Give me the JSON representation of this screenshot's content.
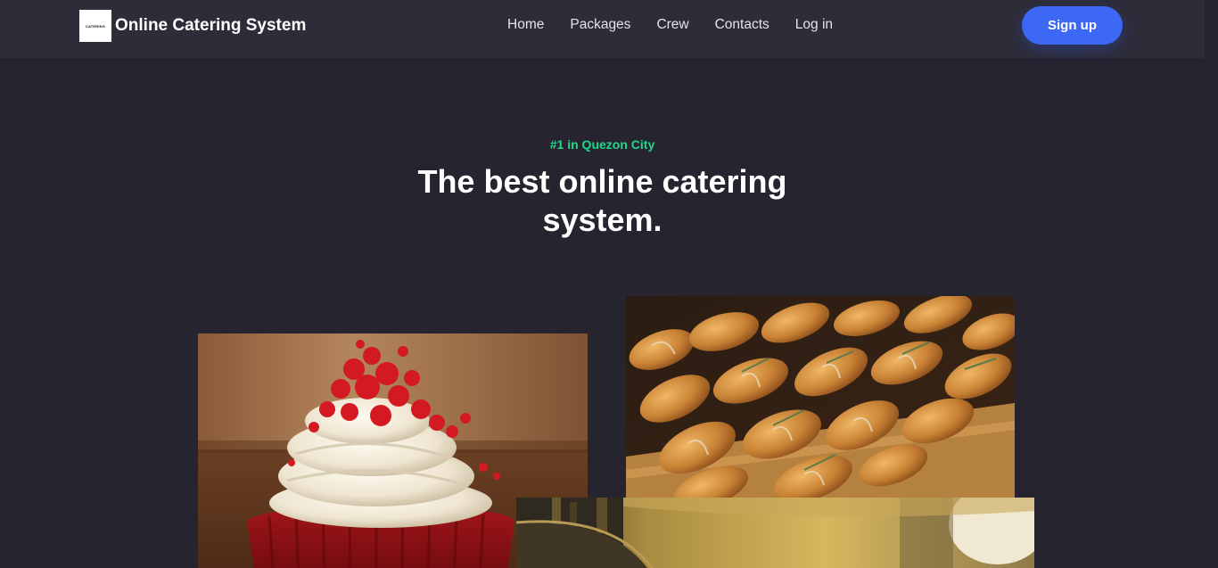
{
  "brand": {
    "logo_text": "CATERING",
    "name": "Online Catering System"
  },
  "nav": {
    "items": [
      {
        "label": "Home"
      },
      {
        "label": "Packages"
      },
      {
        "label": "Crew"
      },
      {
        "label": "Contacts"
      },
      {
        "label": "Log in"
      }
    ],
    "signup_label": "Sign up"
  },
  "hero": {
    "eyebrow": "#1 in Quezon City",
    "headline": "The best online catering system."
  },
  "colors": {
    "background": "#25242f",
    "navbar": "#2d2c38",
    "accent": "#3d67f5",
    "eyebrow": "#1fd98b"
  }
}
